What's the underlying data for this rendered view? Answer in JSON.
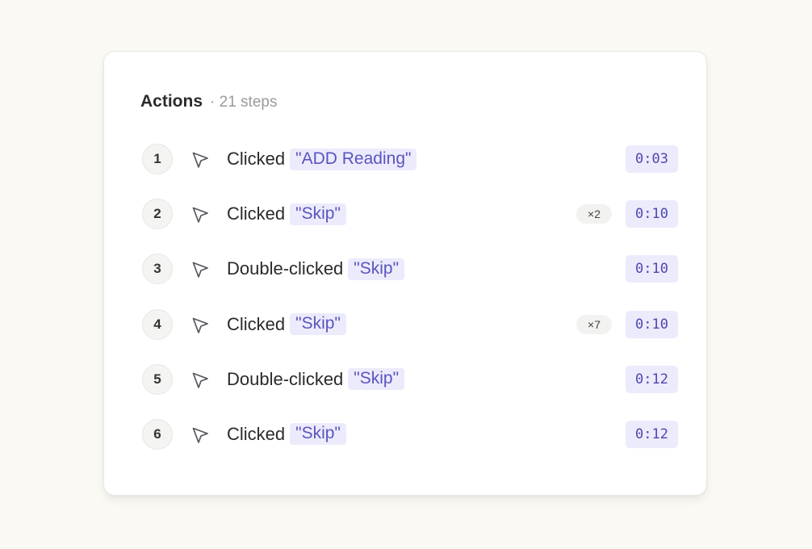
{
  "panel": {
    "title": "Actions",
    "subtitle": "· 21 steps"
  },
  "icons": {
    "cursor": "cursor-arrow-icon"
  },
  "colors": {
    "background": "#faf9f4",
    "accent": "#5a54bf",
    "accent_bg": "#ecebfc",
    "text": "#2a2a2a",
    "muted": "#9a9a9a"
  },
  "actions": [
    {
      "step": "1",
      "verb": "Clicked",
      "target": "\"ADD Reading\"",
      "repeat": "",
      "time": "0:03"
    },
    {
      "step": "2",
      "verb": "Clicked",
      "target": "\"Skip\"",
      "repeat": "×2",
      "time": "0:10"
    },
    {
      "step": "3",
      "verb": "Double-clicked",
      "target": "\"Skip\"",
      "repeat": "",
      "time": "0:10"
    },
    {
      "step": "4",
      "verb": "Clicked",
      "target": "\"Skip\"",
      "repeat": "×7",
      "time": "0:10"
    },
    {
      "step": "5",
      "verb": "Double-clicked",
      "target": "\"Skip\"",
      "repeat": "",
      "time": "0:12"
    },
    {
      "step": "6",
      "verb": "Clicked",
      "target": "\"Skip\"",
      "repeat": "",
      "time": "0:12"
    }
  ]
}
